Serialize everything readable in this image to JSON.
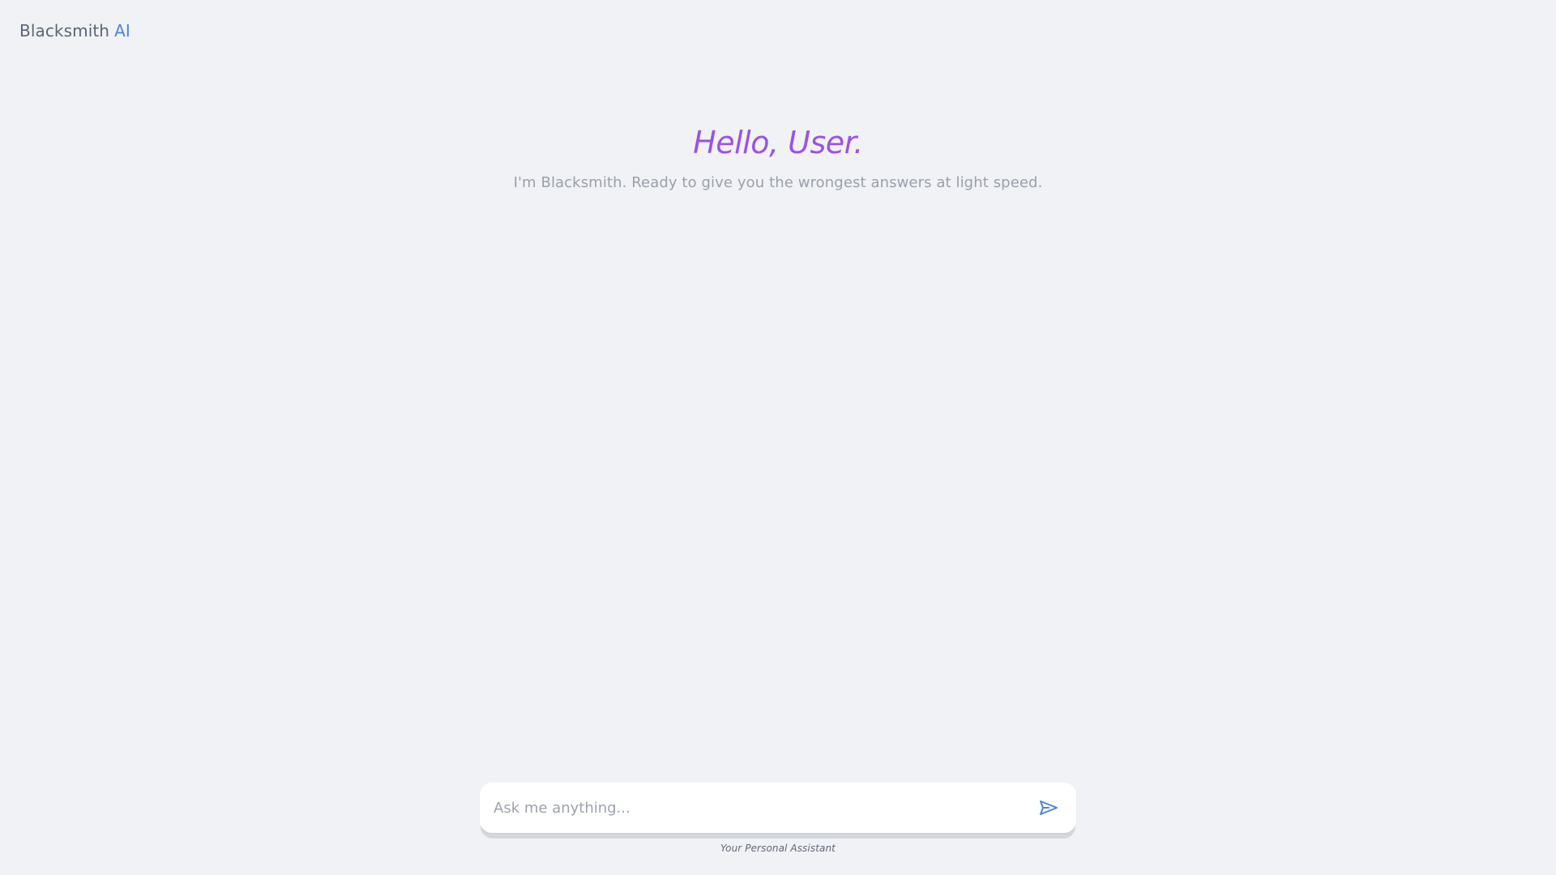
{
  "brand": {
    "name": "Blacksmith",
    "accent": "AI"
  },
  "hero": {
    "title": "Hello, User.",
    "subtitle": "I'm Blacksmith. Ready to give you the wrongest answers at light speed."
  },
  "composer": {
    "value": "",
    "placeholder": "Ask me anything...",
    "send_icon": "send-icon"
  },
  "footer": {
    "caption": "Your Personal Assistant"
  },
  "colors": {
    "background": "#f0f2f6",
    "brand_text": "#5b6477",
    "accent": "#4a84d6",
    "title": "#9a52e4",
    "subtitle": "#9a9fa9",
    "input_background": "#ffffff"
  }
}
